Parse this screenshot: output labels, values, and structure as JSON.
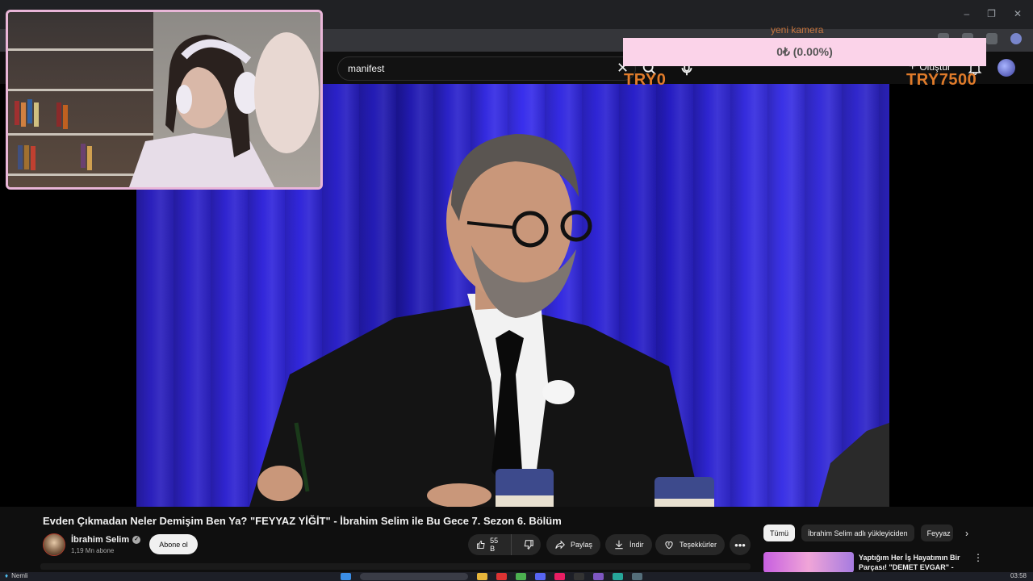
{
  "browser": {
    "window_controls": [
      "–",
      "❐",
      "✕"
    ]
  },
  "header": {
    "search_value": "manifest",
    "create_label": "Oluştur"
  },
  "overlay": {
    "donation_amount": "0₺ (0.00%)",
    "donation_title": "yeni kamera",
    "goal_current": "TRY0",
    "goal_target": "TRY7500"
  },
  "video": {
    "title": "Evden Çıkmadan Neler Demişim Ben Ya? \"FEYYAZ YİĞİT\" - İbrahim Selim ile Bu Gece 7. Sezon 6. Bölüm",
    "channel_name": "İbrahim Selim",
    "subscribers": "1,19 Mn abone",
    "subscribe_label": "Abone ol",
    "like_count": "55 B",
    "share_label": "Paylaş",
    "download_label": "İndir",
    "thanks_label": "Teşekkürler",
    "more_label": "•••"
  },
  "sidebar": {
    "chips": [
      "Tümü",
      "İbrahim Selim adlı yükleyiciden",
      "Feyyaz"
    ],
    "recommendation_title": "Yaptığım Her İş Hayatımın Bir Parçası! \"DEMET EVGAR\" -"
  },
  "taskbar": {
    "weather_label": "Nemli",
    "clock": "03:58"
  },
  "colors": {
    "accent_overlay": "#fbd3e9",
    "goal_text": "#e07b2a",
    "webcam_border": "#e9b6d8"
  }
}
